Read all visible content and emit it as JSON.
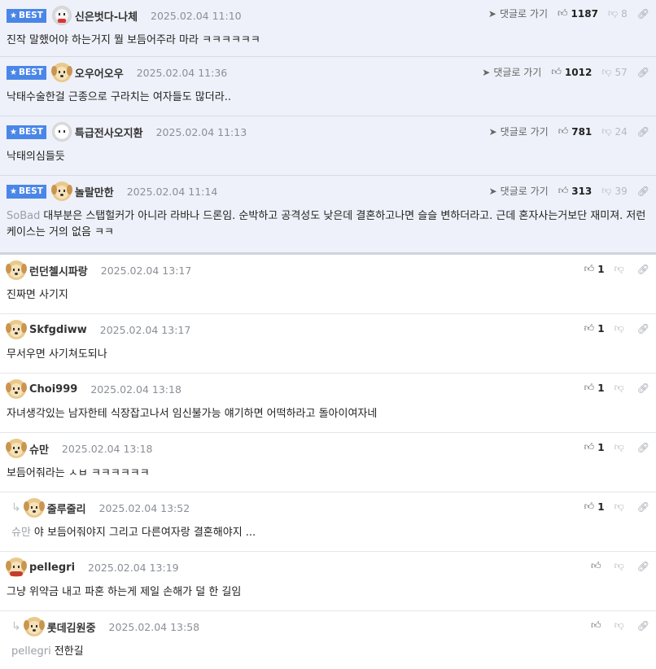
{
  "labels": {
    "best": "BEST",
    "reply_link": "댓글로 가기"
  },
  "comments": [
    {
      "best": true,
      "nick": "신은벗다-나체",
      "date": "2025.02.04 11:10",
      "up": "1187",
      "down": "8",
      "text": "진작 말했어야 하는거지 뭘 보듬어주라 마라 ㅋㅋㅋㅋㅋㅋ",
      "avatar": "bear-icon"
    },
    {
      "best": true,
      "nick": "오우어오우",
      "date": "2025.02.04 11:36",
      "up": "1012",
      "down": "57",
      "text": "낙태수술한걸 근종으로 구라치는 여자들도 많더라..",
      "avatar": "puppy-icon"
    },
    {
      "best": true,
      "nick": "특급전사오지환",
      "date": "2025.02.04 11:13",
      "up": "781",
      "down": "24",
      "text": "낙태의심들듯",
      "avatar": "white-dog-icon"
    },
    {
      "best": true,
      "nick": "놀랄만한",
      "date": "2025.02.04 11:14",
      "up": "313",
      "down": "39",
      "target": "SoBad",
      "text": "대부분은 스탭헐커가 아니라 라바나 드론임. 순박하고 공격성도 낮은데 결혼하고나면 슬슬 변하더라고. 근데 혼자사는거보단 재미져. 저런 케이스는 거의 없음 ㅋㅋ",
      "avatar": "puppy-icon"
    },
    {
      "best": false,
      "nick": "런던첼시파랑",
      "date": "2025.02.04 13:17",
      "up": "1",
      "text": "진짜면 사기지",
      "avatar": "puppy-icon"
    },
    {
      "best": false,
      "nick": "Skfgdiww",
      "date": "2025.02.04 13:17",
      "up": "1",
      "text": "무서우면 사기쳐도되나",
      "avatar": "puppy-icon"
    },
    {
      "best": false,
      "nick": "Choi999",
      "date": "2025.02.04 13:18",
      "up": "1",
      "text": "자녀생각있는 남자한테 식장잡고나서 임신불가능 얘기하면 어떡하라고 돌아이여자네",
      "avatar": "puppy-icon"
    },
    {
      "best": false,
      "nick": "슈만",
      "date": "2025.02.04 13:18",
      "up": "1",
      "text": "보듬어줘라는 ㅅㅂ ㅋㅋㅋㅋㅋㅋ",
      "avatar": "puppy-icon"
    },
    {
      "best": false,
      "reply": true,
      "nick": "줄루줄리",
      "date": "2025.02.04 13:52",
      "up": "1",
      "target": "슈만",
      "text": "야 보듬어줘야지 그리고 다른여자랑 결혼해야지 ...",
      "avatar": "puppy-icon"
    },
    {
      "best": false,
      "nick": "pellegri",
      "date": "2025.02.04 13:19",
      "up": "",
      "text": "그냥 위약금 내고 파혼 하는게 제일 손해가 덜 한 길임",
      "avatar": "red-puppy-icon"
    },
    {
      "best": false,
      "reply": true,
      "nick": "롯데김원중",
      "date": "2025.02.04 13:58",
      "up": "",
      "target": "pellegri",
      "text": "전한길",
      "avatar": "puppy-icon"
    }
  ]
}
